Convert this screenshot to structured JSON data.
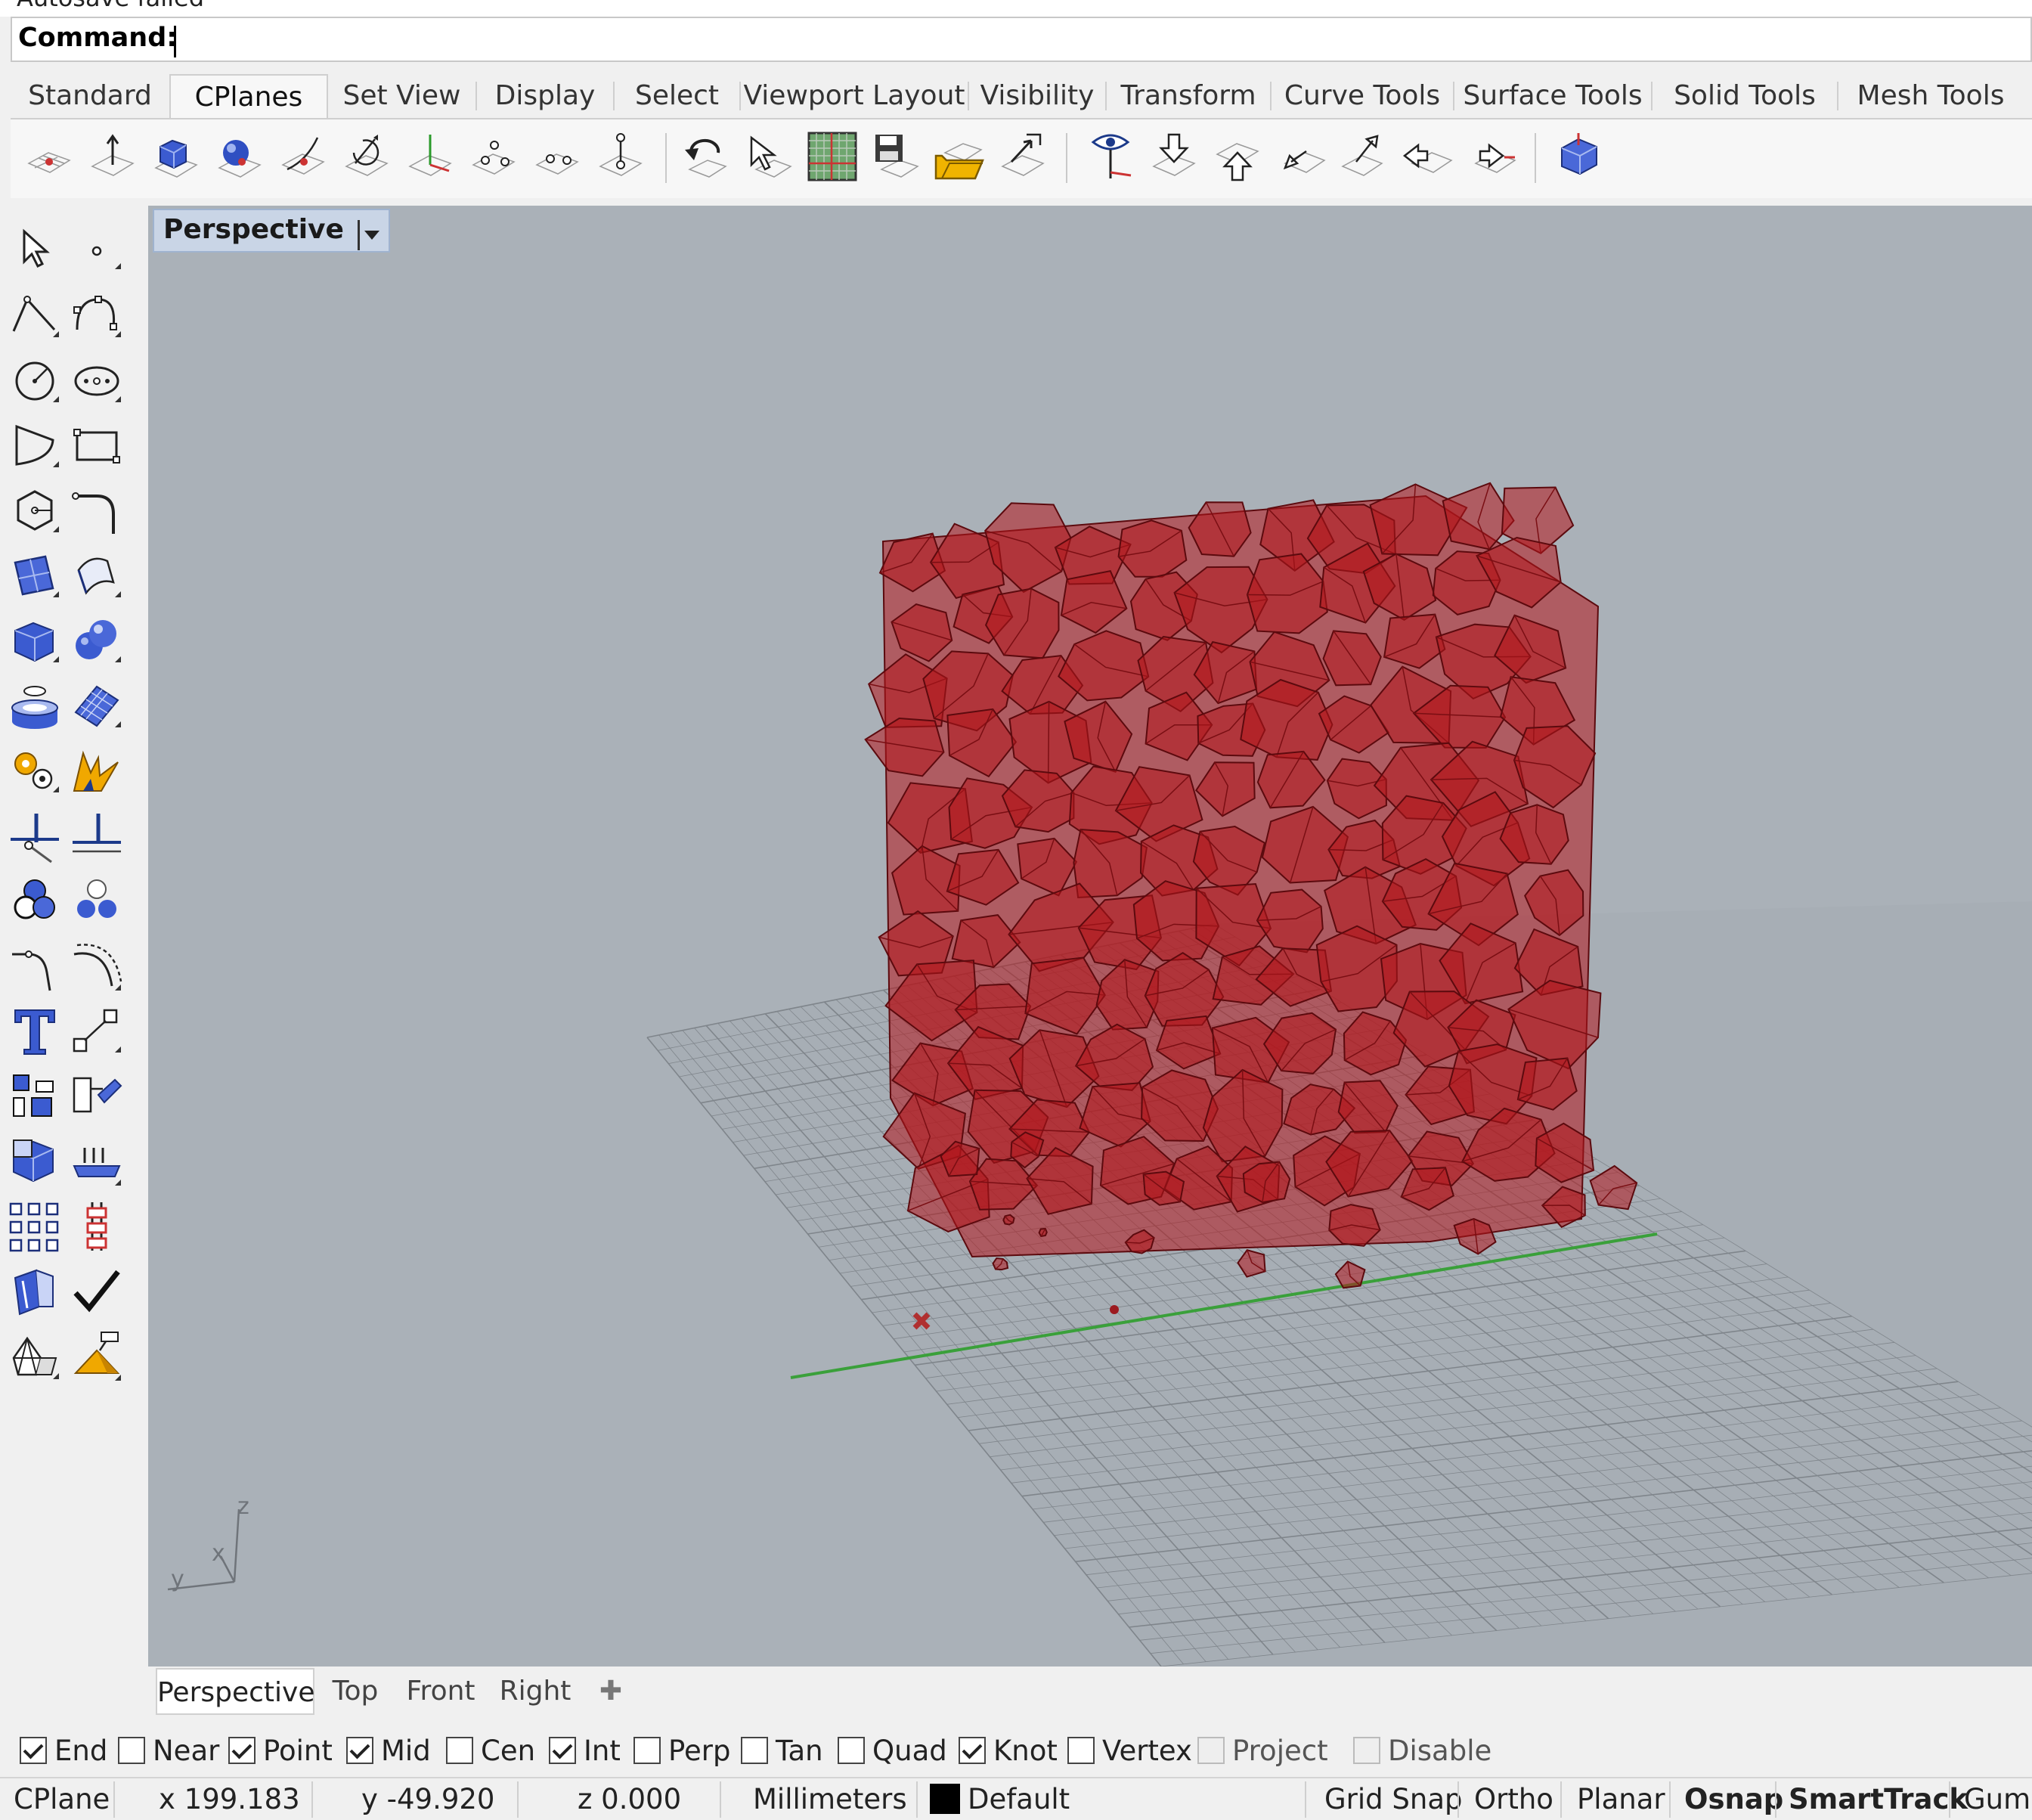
{
  "command": {
    "history_text": "Autosave failed",
    "label": "Command:"
  },
  "toolbar_tabs": [
    "Standard",
    "CPlanes",
    "Set View",
    "Display",
    "Select",
    "Viewport Layout",
    "Visibility",
    "Transform",
    "Curve Tools",
    "Surface Tools",
    "Solid Tools",
    "Mesh Tools"
  ],
  "toolbar_active_tab": "CPlanes",
  "viewport": {
    "title": "Perspective",
    "axis_labels": {
      "z": "z",
      "x": "x",
      "y": "y"
    },
    "object_color": "#b3161c",
    "grid_color": "#7f858b",
    "x_axis_color": "#b03030",
    "y_axis_color": "#3aa03a",
    "background": "#aab1b8"
  },
  "viewport_tabs": [
    "Perspective",
    "Top",
    "Front",
    "Right"
  ],
  "osnaps": [
    {
      "label": "End",
      "checked": true
    },
    {
      "label": "Near",
      "checked": false
    },
    {
      "label": "Point",
      "checked": true
    },
    {
      "label": "Mid",
      "checked": true
    },
    {
      "label": "Cen",
      "checked": false
    },
    {
      "label": "Int",
      "checked": true
    },
    {
      "label": "Perp",
      "checked": false
    },
    {
      "label": "Tan",
      "checked": false
    },
    {
      "label": "Quad",
      "checked": false
    },
    {
      "label": "Knot",
      "checked": true
    },
    {
      "label": "Vertex",
      "checked": false
    },
    {
      "label": "Project",
      "checked": false,
      "disabled": true
    },
    {
      "label": "Disable",
      "checked": false,
      "disabled": true
    }
  ],
  "status": {
    "cplane": "CPlane",
    "x": "x 199.183",
    "y": "y -49.920",
    "z": "z 0.000",
    "units": "Millimeters",
    "layer": "Default",
    "layer_color": "#000000",
    "toggles": [
      "Grid Snap",
      "Ortho",
      "Planar",
      "Osnap",
      "SmartTrack",
      "Gumb"
    ],
    "active_toggles": [
      "Osnap",
      "SmartTrack"
    ]
  }
}
